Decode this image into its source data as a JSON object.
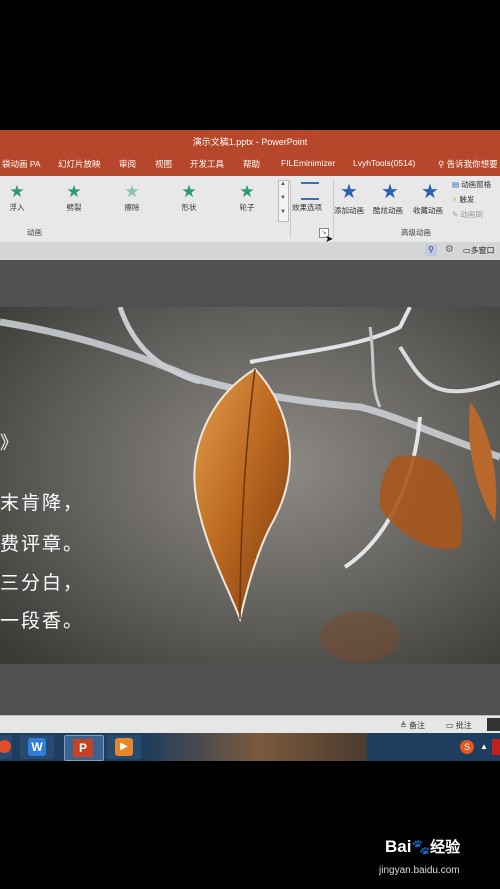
{
  "window": {
    "title": "演示文稿1.pptx  -  PowerPoint"
  },
  "tabs": [
    {
      "label": "袋动画 PA"
    },
    {
      "label": "幻灯片放映"
    },
    {
      "label": "审阅"
    },
    {
      "label": "视图"
    },
    {
      "label": "开发工具"
    },
    {
      "label": "帮助"
    },
    {
      "label": "FILEminimizer"
    },
    {
      "label": "LvyhTools(0514)"
    }
  ],
  "tell_me": {
    "icon": "search-icon",
    "label": "告诉我你想要"
  },
  "ribbon": {
    "animations": [
      {
        "label": "浮入",
        "icon": "star-icon"
      },
      {
        "label": "劈裂",
        "icon": "star-icon"
      },
      {
        "label": "擦除",
        "icon": "star-icon"
      },
      {
        "label": "形状",
        "icon": "star-icon"
      },
      {
        "label": "轮子",
        "icon": "star-icon"
      }
    ],
    "effect_options": "效果选项",
    "group_animation": "动画",
    "add_animation": "添加动画",
    "cool_animation": "酷炫动画",
    "favorite_animation": "收藏动画",
    "animation_pane": "动画窗格",
    "trigger": "触发",
    "animation_painter": "动画刷",
    "group_advanced": "高级动画",
    "multi_window": "多窗口"
  },
  "slide": {
    "lines": [
      "末肯降，",
      "费评章。",
      "三分白，",
      "一段香。"
    ],
    "mark": "》"
  },
  "status": {
    "notes": "备注",
    "comments": "批注"
  },
  "taskbar": {
    "apps": [
      {
        "name": "browser-icon",
        "color": "#e34b2a"
      },
      {
        "name": "wps-writer-icon",
        "color": "#2f7fd8",
        "label": "W"
      },
      {
        "name": "powerpoint-icon",
        "color": "#c84124",
        "label": "P"
      },
      {
        "name": "media-player-icon",
        "color": "#e8872a"
      }
    ]
  },
  "watermark": {
    "brand": "Bai",
    "brand_cn": "经验",
    "url": "jingyan.baidu.com"
  }
}
